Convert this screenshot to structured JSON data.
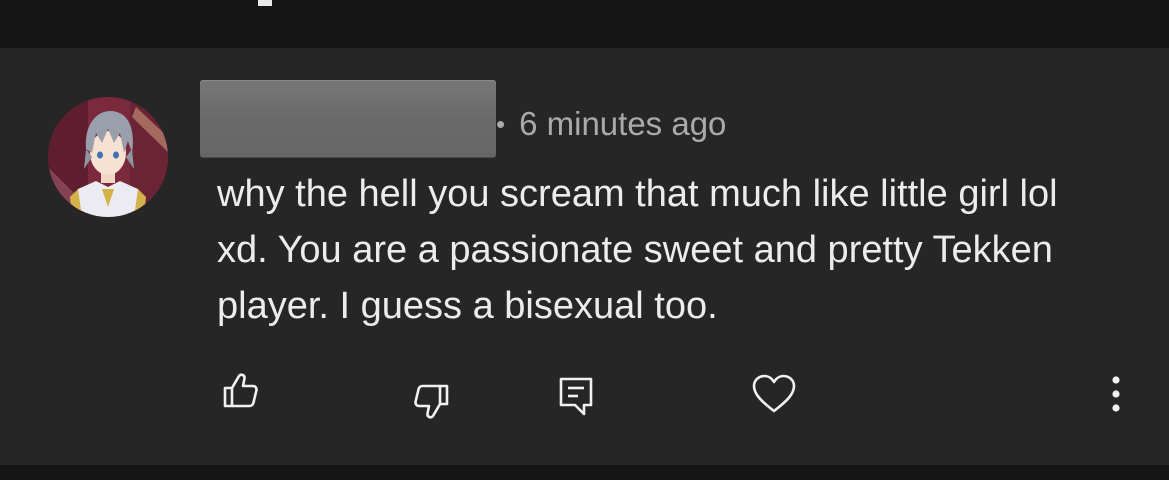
{
  "comment": {
    "timestamp": "6 minutes ago",
    "separator": "•",
    "text": "why the hell you scream that much like little girl lol xd. You are a passionate sweet and pretty Tekken player. I guess a bisexual too."
  },
  "actions": {
    "icons": [
      "thumb-up-icon",
      "thumb-down-icon",
      "reply-icon",
      "heart-icon",
      "more-options-icon"
    ]
  },
  "colors": {
    "background": "#262626",
    "outer_background": "#151515",
    "text_primary": "#ececec",
    "text_secondary": "#aaaaaa",
    "icon": "#f1f1f1"
  }
}
